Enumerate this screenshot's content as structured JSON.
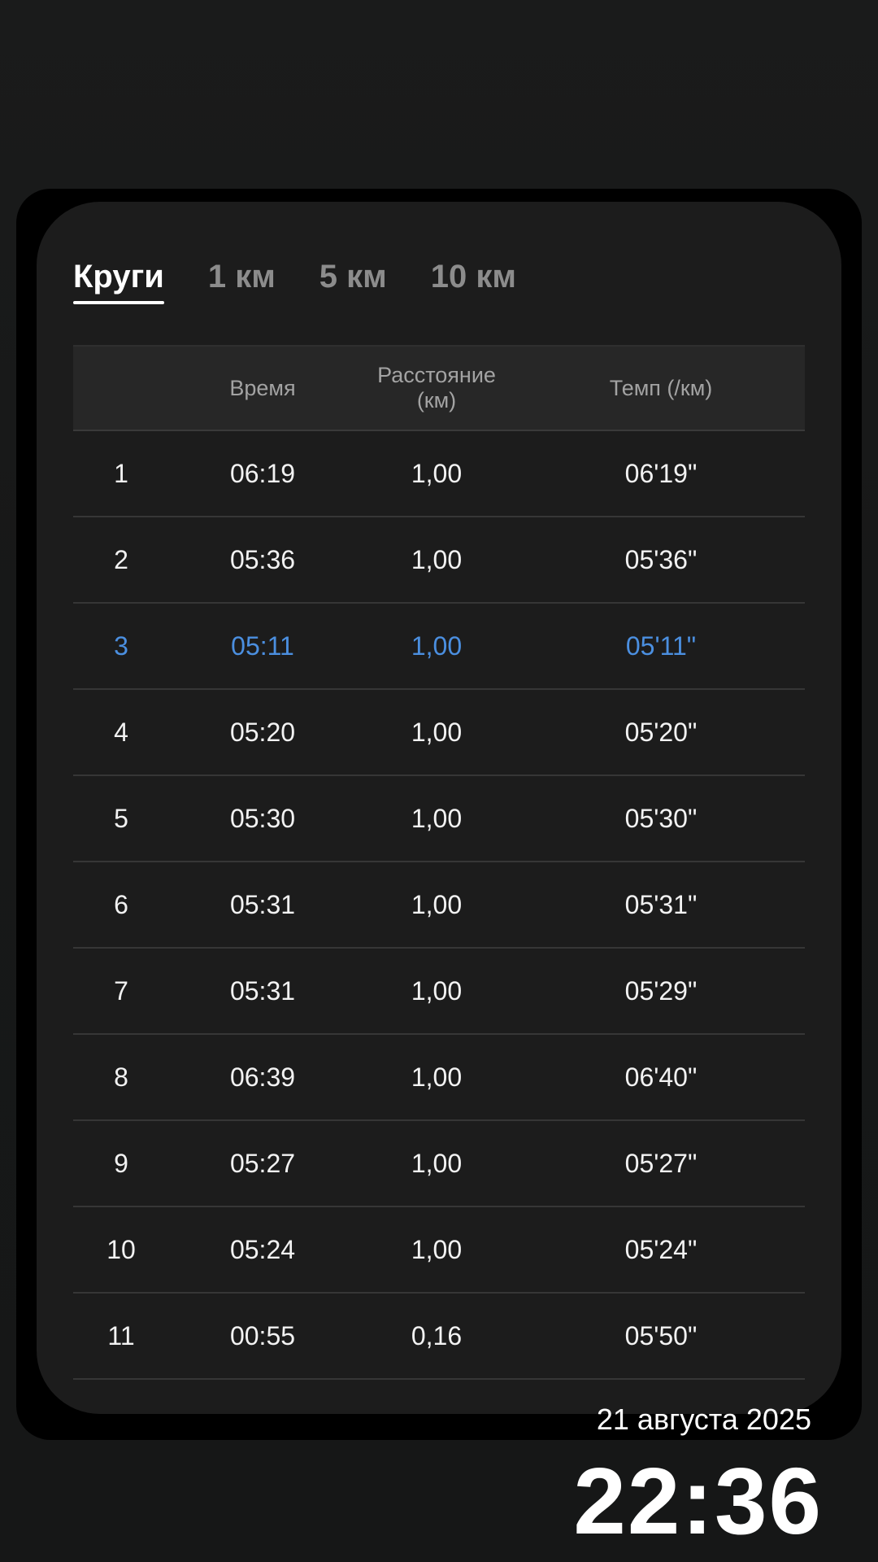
{
  "tabs": [
    {
      "label": "Круги"
    },
    {
      "label": "1 км"
    },
    {
      "label": "5 км"
    },
    {
      "label": "10 км"
    }
  ],
  "active_tab": "Круги",
  "table": {
    "headers": [
      "",
      "Время",
      "Расстояние (км)",
      "Темп (/км)"
    ],
    "rows": [
      {
        "lap": "1",
        "time": "06:19",
        "distance": "1,00",
        "pace": "06'19\""
      },
      {
        "lap": "2",
        "time": "05:36",
        "distance": "1,00",
        "pace": "05'36\""
      },
      {
        "lap": "3",
        "time": "05:11",
        "distance": "1,00",
        "pace": "05'11\""
      },
      {
        "lap": "4",
        "time": "05:20",
        "distance": "1,00",
        "pace": "05'20\""
      },
      {
        "lap": "5",
        "time": "05:30",
        "distance": "1,00",
        "pace": "05'30\""
      },
      {
        "lap": "6",
        "time": "05:31",
        "distance": "1,00",
        "pace": "05'31\""
      },
      {
        "lap": "7",
        "time": "05:31",
        "distance": "1,00",
        "pace": "05'29\""
      },
      {
        "lap": "8",
        "time": "06:39",
        "distance": "1,00",
        "pace": "06'40\""
      },
      {
        "lap": "9",
        "time": "05:27",
        "distance": "1,00",
        "pace": "05'27\""
      },
      {
        "lap": "10",
        "time": "05:24",
        "distance": "1,00",
        "pace": "05'24\""
      },
      {
        "lap": "11",
        "time": "00:55",
        "distance": "0,16",
        "pace": "05'50\""
      }
    ],
    "highlight_color": "#4b8fe0"
  },
  "footer": {
    "date": "21 августа 2025",
    "time": "22:36"
  }
}
